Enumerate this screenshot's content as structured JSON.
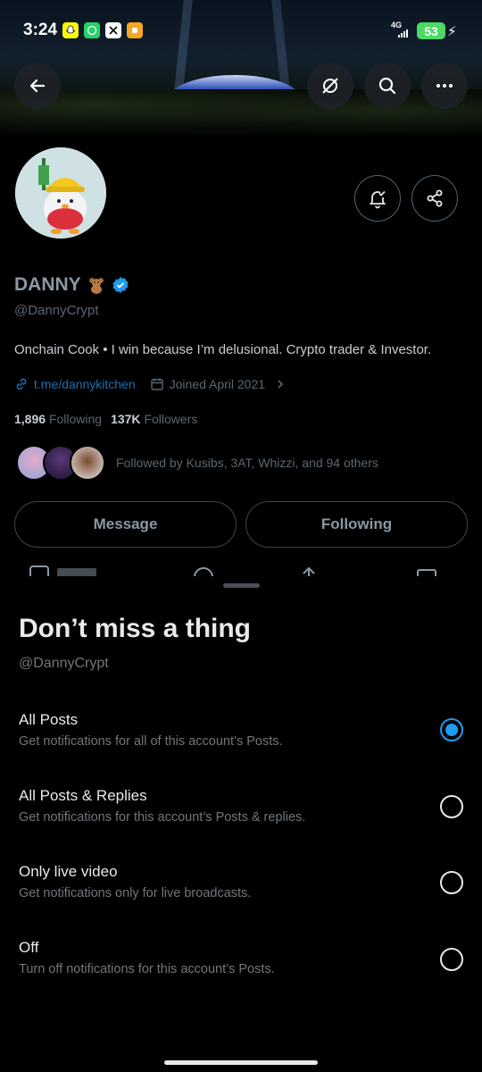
{
  "status_bar": {
    "time": "3:24",
    "network": "4G",
    "battery": "53",
    "apps": [
      "snapchat-icon",
      "whatsapp-icon",
      "x-icon",
      "app-icon"
    ]
  },
  "profile": {
    "name": "DANNY",
    "handle": "@DannyCrypt",
    "bio": "Onchain Cook • I win because I’m delusional. Crypto trader & Investor.",
    "link": "t.me/dannykitchen",
    "joined": "Joined April 2021",
    "following_count": "1,896",
    "following_label": "Following",
    "followers_count": "137K",
    "followers_label": "Followers",
    "followed_by": "Followed by Kusibs, 3AT, Whizzi, and 94 others",
    "message_label": "Message",
    "following_button_label": "Following"
  },
  "sheet": {
    "title": "Don’t miss a thing",
    "handle": "@DannyCrypt",
    "options": [
      {
        "title": "All Posts",
        "description": "Get notifications for all of this account’s Posts.",
        "selected": true
      },
      {
        "title": "All Posts & Replies",
        "description": "Get notifications for this account’s Posts & replies.",
        "selected": false
      },
      {
        "title": "Only live video",
        "description": "Get notifications only for live broadcasts.",
        "selected": false
      },
      {
        "title": "Off",
        "description": "Turn off notifications for this account’s Posts.",
        "selected": false
      }
    ]
  },
  "colors": {
    "accent": "#1d9bf0",
    "background": "#000000",
    "primary_text": "#e7e9ea",
    "secondary_text": "#71767b",
    "battery": "#4cd964"
  }
}
